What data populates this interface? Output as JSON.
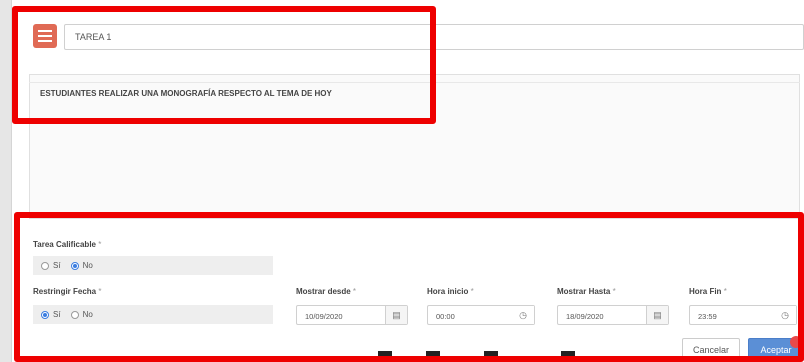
{
  "task": {
    "icon": "task-list-icon",
    "title_value": "TAREA 1",
    "description": "ESTUDIANTES REALIZAR UNA MONOGRAFÍA RESPECTO AL TEMA DE HOY"
  },
  "gradable": {
    "label": "Tarea Calificable",
    "required_mark": "*",
    "options": [
      {
        "label": "Sí",
        "selected": false
      },
      {
        "label": "No",
        "selected": true
      }
    ]
  },
  "restrict_date": {
    "label": "Restringir Fecha",
    "required_mark": "*",
    "options": [
      {
        "label": "Sí",
        "selected": true
      },
      {
        "label": "No",
        "selected": false
      }
    ]
  },
  "show_from": {
    "label": "Mostrar desde",
    "required_mark": "*",
    "value": "10/09/2020",
    "icon": "calendar-icon"
  },
  "start_time": {
    "label": "Hora inicio",
    "required_mark": "*",
    "value": "00:00",
    "icon": "clock-icon"
  },
  "show_until": {
    "label": "Mostrar Hasta",
    "required_mark": "*",
    "value": "18/09/2020",
    "icon": "calendar-icon"
  },
  "end_time": {
    "label": "Hora Fin",
    "required_mark": "*",
    "value": "23:59",
    "icon": "clock-icon"
  },
  "actions": {
    "cancel_label": "Cancelar",
    "accept_label": "Aceptar"
  },
  "colors": {
    "highlight": "#ee0000",
    "primary": "#5b8fd6",
    "task_icon": "#e06a55"
  }
}
